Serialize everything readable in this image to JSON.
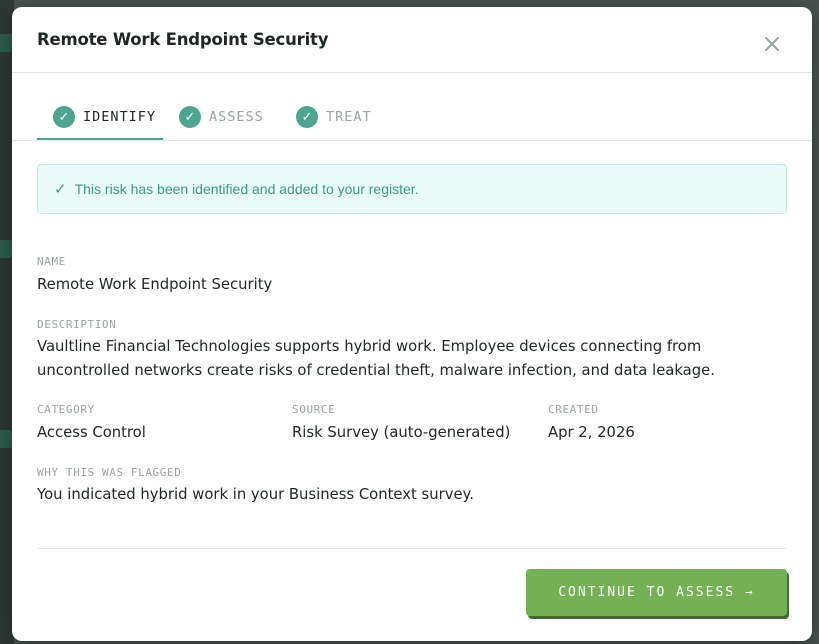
{
  "modal": {
    "title": "Remote Work Endpoint Security",
    "close_icon": "close-icon"
  },
  "stepper": {
    "steps": [
      {
        "label": "IDENTIFY",
        "state": "active",
        "icon": "check-icon"
      },
      {
        "label": "ASSESS",
        "state": "complete",
        "icon": "check-icon"
      },
      {
        "label": "TREAT",
        "state": "complete",
        "icon": "check-icon"
      }
    ],
    "accent_color": "#4ca58f"
  },
  "alert": {
    "icon": "check-icon",
    "icon_glyph": "✓",
    "text": "This risk has been identified and added to your register."
  },
  "fields": {
    "name": {
      "label": "NAME",
      "value": "Remote Work Endpoint Security"
    },
    "description": {
      "label": "DESCRIPTION",
      "value": "Vaultline Financial Technologies supports hybrid work. Employee devices connecting from uncontrolled networks create risks of credential theft, malware infection, and data leakage."
    },
    "category": {
      "label": "CATEGORY",
      "value": "Access Control"
    },
    "source": {
      "label": "SOURCE",
      "value": "Risk Survey (auto-generated)"
    },
    "created": {
      "label": "CREATED",
      "value": "Apr 2, 2026"
    },
    "why_flagged": {
      "label": "WHY THIS WAS FLAGGED",
      "value": "You indicated hybrid work in your Business Context survey."
    }
  },
  "footer": {
    "continue_label": "CONTINUE TO ASSESS →",
    "button_color": "#73b154"
  }
}
